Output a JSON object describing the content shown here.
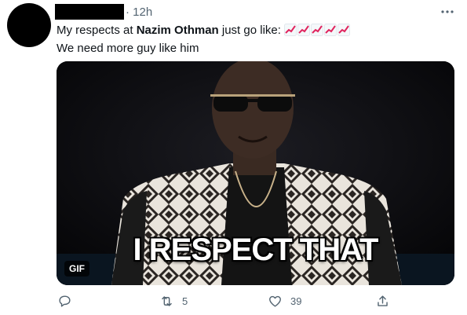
{
  "tweet": {
    "timestamp": "· 12h",
    "text_prefix": "My respects at ",
    "mention": "Nazim Othman",
    "text_suffix": " just go like: ",
    "line2": "We need more guy like him",
    "emoji_icon": "chart-increasing",
    "emoji_count": 5
  },
  "media": {
    "caption": "I RESPECT THAT",
    "badge": "GIF"
  },
  "actions": {
    "reply_count": "",
    "retweet_count": "5",
    "like_count": "39"
  },
  "colors": {
    "text": "#0f1419",
    "muted": "#536471",
    "emoji_arrow": "#e0245e"
  }
}
